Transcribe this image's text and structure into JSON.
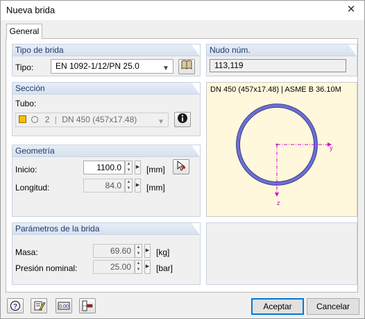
{
  "window": {
    "title": "Nueva brida",
    "close_glyph": "✕"
  },
  "tabs": [
    {
      "label": "General"
    }
  ],
  "tipo_brida": {
    "header": "Tipo de brida",
    "label": "Tipo:",
    "value": "EN 1092-1/12/PN 25.0",
    "library_icon": "book-icon"
  },
  "nudo": {
    "header": "Nudo núm.",
    "value": "113,119"
  },
  "seccion": {
    "header": "Sección",
    "tubo_label": "Tubo:",
    "number": "2",
    "value": "DN 450 (457x17.48)",
    "swatch_color": "#f2c200",
    "info_icon": "info-icon"
  },
  "geometria": {
    "header": "Geometría",
    "inicio_label": "Inicio:",
    "inicio_value": "1100.0",
    "inicio_unit": "[mm]",
    "longitud_label": "Longitud:",
    "longitud_value": "84.0",
    "longitud_unit": "[mm]",
    "pick_icon": "pick-node-icon"
  },
  "parametros": {
    "header": "Parámetros de la brida",
    "masa_label": "Masa:",
    "masa_value": "69.60",
    "masa_unit": "[kg]",
    "presion_label": "Presión nominal:",
    "presion_value": "25.00",
    "presion_unit": "[bar]"
  },
  "preview": {
    "caption": "DN 450 (457x17.48) | ASME B 36.10M",
    "axis_y": "y",
    "axis_z": "z",
    "ring_color": "#6b6fd6",
    "axis_color": "#d400d4"
  },
  "footer": {
    "accept_label": "Aceptar",
    "cancel_label": "Cancelar",
    "icons": [
      "help-icon",
      "edit-icon",
      "units-icon",
      "view-icon"
    ]
  }
}
